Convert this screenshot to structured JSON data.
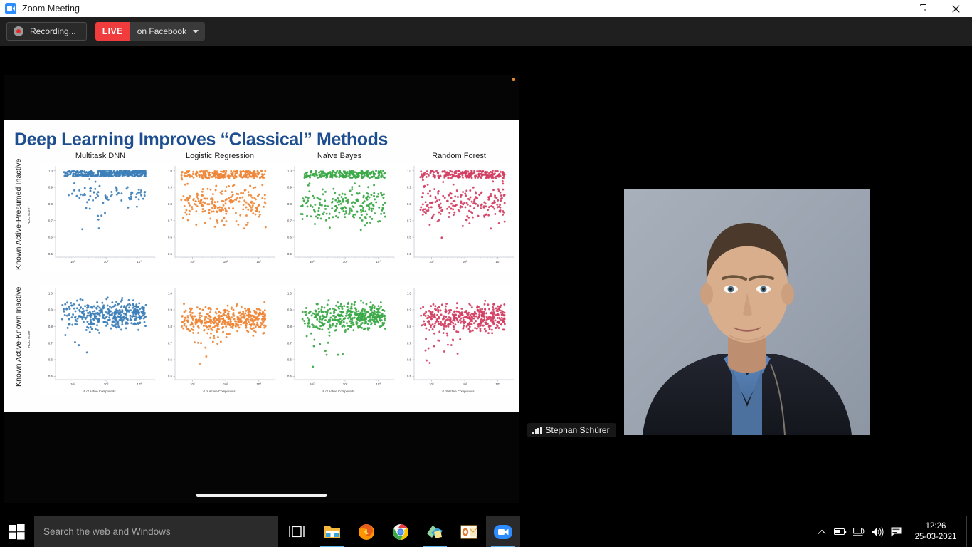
{
  "window": {
    "title": "Zoom Meeting",
    "app_icon": "zoom-video-icon",
    "controls": {
      "minimize": "—",
      "maximize": "❐",
      "close": "✕"
    }
  },
  "toolbar": {
    "recording_label": "Recording...",
    "live_badge": "LIVE",
    "live_destination": "on Facebook",
    "caret": "chevron-down-icon"
  },
  "participant": {
    "name": "Stephan Schürer",
    "audio_icon": "audio-level-icon"
  },
  "slide": {
    "title": "Deep Learning Improves “Classical” Methods",
    "row_labels": [
      "Known Active-Presumed Inactive",
      "Known Active-Known Inactive"
    ],
    "column_headers": [
      "Multitask DNN",
      "Logistic Regression",
      "Naïve Bayes",
      "Random Forest"
    ],
    "y_axis_label": "ROC Score",
    "x_axis_label": "# of Active Compounds",
    "y_ticks": [
      "1.0",
      "0.9",
      "0.8",
      "0.7",
      "0.6",
      "0.5"
    ],
    "x_ticks": [
      "10²",
      "10³",
      "10⁴"
    ],
    "title_color": "#1d4e8f"
  },
  "chart_data": {
    "type": "scatter",
    "title": "Deep Learning Improves “Classical” Methods",
    "xlabel": "# of Active Compounds",
    "ylabel": "ROC Score",
    "xscale": "log",
    "xlim": [
      30,
      30000
    ],
    "ylim": [
      0.48,
      1.02
    ],
    "grid": false,
    "legend": "none",
    "xtick_labels": [
      "10²",
      "10³",
      "10⁴"
    ],
    "ytick_labels": [
      "0.5",
      "0.6",
      "0.7",
      "0.8",
      "0.9",
      "1.0"
    ],
    "panel_columns": [
      "Multitask DNN",
      "Logistic Regression",
      "Naïve Bayes",
      "Random Forest"
    ],
    "panel_rows": [
      "Known Active-Presumed Inactive",
      "Known Active-Known Inactive"
    ],
    "series": [
      {
        "name": "Multitask DNN / Known Active-Presumed Inactive",
        "color": "#3d7fb8",
        "n_points": 420,
        "y_median": 0.98,
        "y_min": 0.58,
        "y_q1": 0.96,
        "y_q3": 0.995,
        "density": "very-dense-top"
      },
      {
        "name": "Logistic Regression / Known Active-Presumed Inactive",
        "color": "#ef8636",
        "n_points": 420,
        "y_median": 0.94,
        "y_min": 0.5,
        "y_q1": 0.88,
        "y_q3": 0.98,
        "density": "dense-top-spread-low"
      },
      {
        "name": "Naïve Bayes / Known Active-Presumed Inactive",
        "color": "#3aa845",
        "n_points": 420,
        "y_median": 0.92,
        "y_min": 0.5,
        "y_q1": 0.84,
        "y_q3": 0.97,
        "density": "broad-spread"
      },
      {
        "name": "Random Forest / Known Active-Presumed Inactive",
        "color": "#d23f63",
        "n_points": 420,
        "y_median": 0.93,
        "y_min": 0.5,
        "y_q1": 0.85,
        "y_q3": 0.98,
        "density": "broad-spread"
      },
      {
        "name": "Multitask DNN / Known Active-Known Inactive",
        "color": "#3d7fb8",
        "n_points": 400,
        "y_median": 0.87,
        "y_min": 0.5,
        "y_q1": 0.79,
        "y_q3": 0.93,
        "density": "mid-spread"
      },
      {
        "name": "Logistic Regression / Known Active-Known Inactive",
        "color": "#ef8636",
        "n_points": 400,
        "y_median": 0.84,
        "y_min": 0.5,
        "y_q1": 0.74,
        "y_q3": 0.92,
        "density": "mid-spread"
      },
      {
        "name": "Naïve Bayes / Known Active-Known Inactive",
        "color": "#3aa845",
        "n_points": 400,
        "y_median": 0.86,
        "y_min": 0.5,
        "y_q1": 0.77,
        "y_q3": 0.93,
        "density": "mid-spread"
      },
      {
        "name": "Random Forest / Known Active-Known Inactive",
        "color": "#d23f63",
        "n_points": 400,
        "y_median": 0.85,
        "y_min": 0.5,
        "y_q1": 0.75,
        "y_q3": 0.93,
        "density": "mid-spread"
      }
    ]
  },
  "taskbar": {
    "start_label": "start-button",
    "search_placeholder": "Search the web and Windows",
    "task_view": "task-view-icon",
    "apps": [
      {
        "name": "file-explorer",
        "open": true
      },
      {
        "name": "firefox",
        "open": false
      },
      {
        "name": "google-chrome",
        "open": true
      },
      {
        "name": "sticky-notes",
        "open": true
      },
      {
        "name": "outlook",
        "open": false
      },
      {
        "name": "zoom",
        "open": true,
        "active": true
      }
    ],
    "tray": [
      "chevron-up-icon",
      "battery-icon",
      "network-icon",
      "volume-icon",
      "action-center-icon"
    ],
    "clock_time": "12:26",
    "clock_date": "25-03-2021"
  }
}
